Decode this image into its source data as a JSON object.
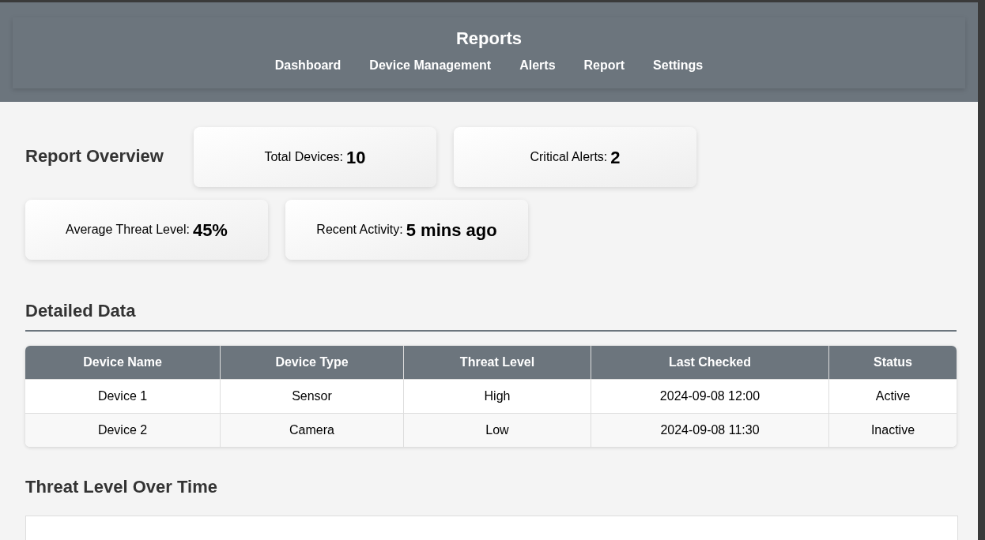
{
  "header": {
    "title": "Reports",
    "nav": [
      {
        "label": "Dashboard"
      },
      {
        "label": "Device Management"
      },
      {
        "label": "Alerts"
      },
      {
        "label": "Report"
      },
      {
        "label": "Settings"
      }
    ]
  },
  "overview": {
    "title": "Report Overview",
    "stats": [
      {
        "label": "Total Devices:",
        "value": "10"
      },
      {
        "label": "Critical Alerts:",
        "value": "2"
      },
      {
        "label": "Average Threat Level:",
        "value": "45%"
      },
      {
        "label": "Recent Activity:",
        "value": "5 mins ago"
      }
    ]
  },
  "detailed": {
    "title": "Detailed Data",
    "table": {
      "columns": [
        "Device Name",
        "Device Type",
        "Threat Level",
        "Last Checked",
        "Status"
      ],
      "rows": [
        [
          "Device 1",
          "Sensor",
          "High",
          "2024-09-08 12:00",
          "Active"
        ],
        [
          "Device 2",
          "Camera",
          "Low",
          "2024-09-08 11:30",
          "Inactive"
        ]
      ]
    }
  },
  "chart_section": {
    "title": "Threat Level Over Time"
  }
}
